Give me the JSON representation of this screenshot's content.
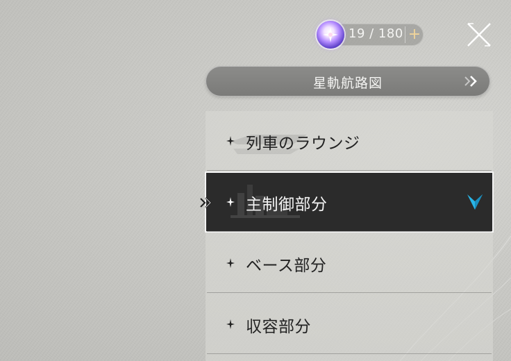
{
  "fuel": {
    "count_label": "19 / 180",
    "plus_label": "+",
    "icon": "trailblaze-fuel-icon"
  },
  "close": {
    "icon": "close-icon"
  },
  "map_button": {
    "label": "星軌航路図",
    "icon": "double-chevron-right-icon"
  },
  "zones": [
    {
      "label": "列車のラウンジ",
      "icon": "sparkle-star-icon",
      "active": false
    },
    {
      "label": "主制御部分",
      "icon": "sparkle-star-icon",
      "active": true
    },
    {
      "label": "ベース部分",
      "icon": "sparkle-star-icon",
      "active": false
    },
    {
      "label": "収容部分",
      "icon": "sparkle-star-icon",
      "active": false
    }
  ],
  "colors": {
    "active_bg": "#2b2b2b",
    "active_marker": "#29b6e8",
    "plus_accent": "#f0d49a"
  }
}
